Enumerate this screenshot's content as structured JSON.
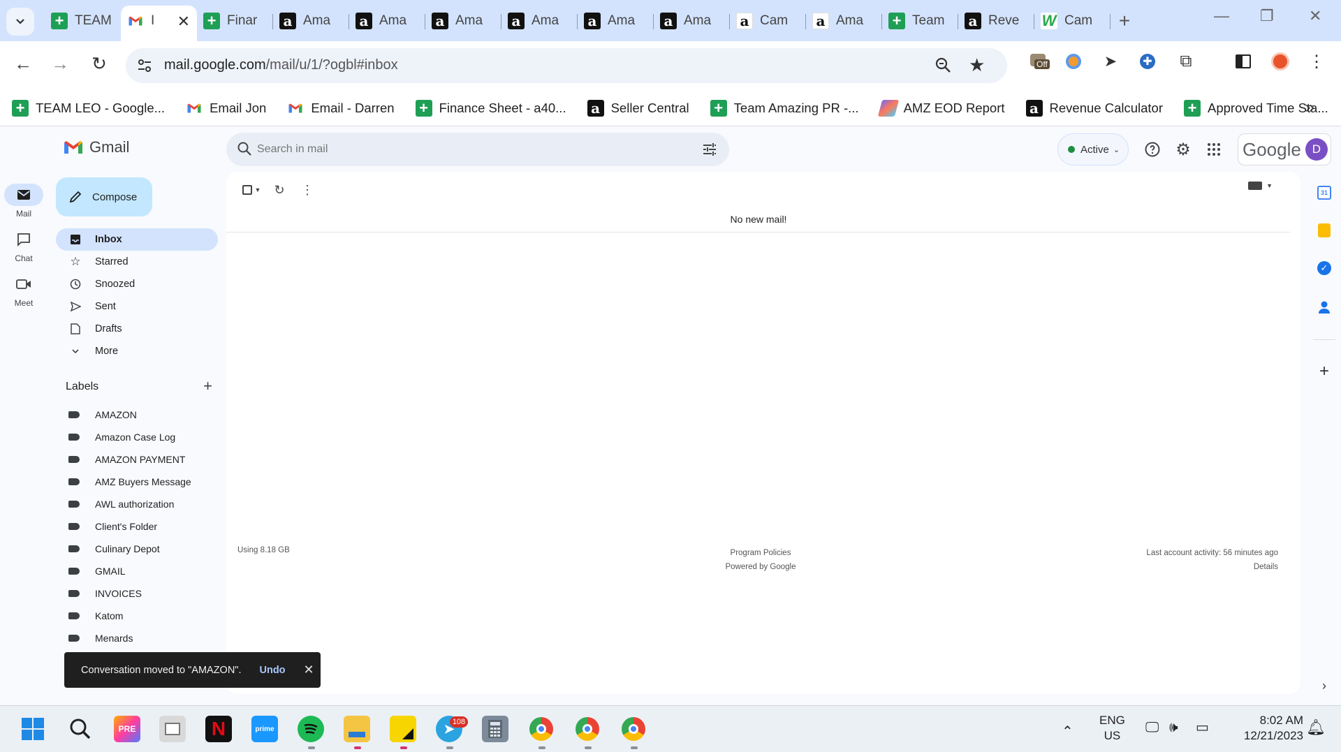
{
  "browser": {
    "tabs": [
      {
        "label": "TEAM",
        "icon": "sheets-icon"
      },
      {
        "label": "I",
        "icon": "gmail-icon",
        "active": true
      },
      {
        "label": "Finar",
        "icon": "sheets-icon"
      },
      {
        "label": "Ama",
        "icon": "amazon-icon"
      },
      {
        "label": "Ama",
        "icon": "amazon-icon"
      },
      {
        "label": "Ama",
        "icon": "amazon-icon"
      },
      {
        "label": "Ama",
        "icon": "amazon-icon"
      },
      {
        "label": "Ama",
        "icon": "amazon-icon"
      },
      {
        "label": "Ama",
        "icon": "amazon-icon"
      },
      {
        "label": "Cam",
        "icon": "amazon-light-icon"
      },
      {
        "label": "Ama",
        "icon": "amazon-light-icon"
      },
      {
        "label": "Team",
        "icon": "sheets-icon"
      },
      {
        "label": "Reve",
        "icon": "amazon-icon"
      },
      {
        "label": "Cam",
        "icon": "w-icon"
      }
    ],
    "url_host": "mail.google.com",
    "url_path": "/mail/u/1/?ogbl#inbox",
    "extension_badge": "Off",
    "bookmarks": [
      {
        "label": "TEAM LEO - Google...",
        "icon": "sheets-icon"
      },
      {
        "label": "Email Jon",
        "icon": "gmail-icon"
      },
      {
        "label": "Email - Darren",
        "icon": "gmail-icon"
      },
      {
        "label": "Finance Sheet - a40...",
        "icon": "sheets-icon"
      },
      {
        "label": "Seller Central",
        "icon": "amazon-icon"
      },
      {
        "label": "Team Amazing PR -...",
        "icon": "sheets-icon"
      },
      {
        "label": "AMZ EOD Report",
        "icon": "clickup-icon"
      },
      {
        "label": "Revenue Calculator",
        "icon": "amazon-icon"
      },
      {
        "label": "Approved Time Sta...",
        "icon": "sheets-icon"
      }
    ]
  },
  "gmail": {
    "app_name": "Gmail",
    "rail": [
      {
        "label": "Mail",
        "icon": "mail-icon"
      },
      {
        "label": "Chat",
        "icon": "chat-icon"
      },
      {
        "label": "Meet",
        "icon": "video-icon"
      }
    ],
    "search_placeholder": "Search in mail",
    "status": "Active",
    "account_word": "Google",
    "avatar_letter": "D",
    "compose_label": "Compose",
    "nav": [
      {
        "label": "Inbox",
        "icon": "inbox-icon"
      },
      {
        "label": "Starred",
        "icon": "star-icon"
      },
      {
        "label": "Snoozed",
        "icon": "clock-icon"
      },
      {
        "label": "Sent",
        "icon": "send-icon"
      },
      {
        "label": "Drafts",
        "icon": "draft-icon"
      },
      {
        "label": "More",
        "icon": "chevron-down-icon"
      }
    ],
    "labels_heading": "Labels",
    "labels": [
      "AMAZON",
      "Amazon Case Log",
      "AMAZON PAYMENT",
      "AMZ Buyers Message",
      "AWL authorization",
      "Client's Folder",
      "Culinary Depot",
      "GMAIL",
      "INVOICES",
      "Katom",
      "Menards"
    ],
    "empty_message": "No new mail!",
    "footer": {
      "storage": "Using 8.18 GB",
      "policies": "Program Policies",
      "powered": "Powered by Google",
      "activity": "Last account activity: 56 minutes ago",
      "details": "Details"
    },
    "toast": {
      "message": "Conversation moved to \"AMAZON\".",
      "action": "Undo"
    }
  },
  "taskbar": {
    "telegram_badge": "108",
    "lang_line1": "ENG",
    "lang_line2": "US",
    "time": "8:02 AM",
    "date": "12/21/2023"
  }
}
